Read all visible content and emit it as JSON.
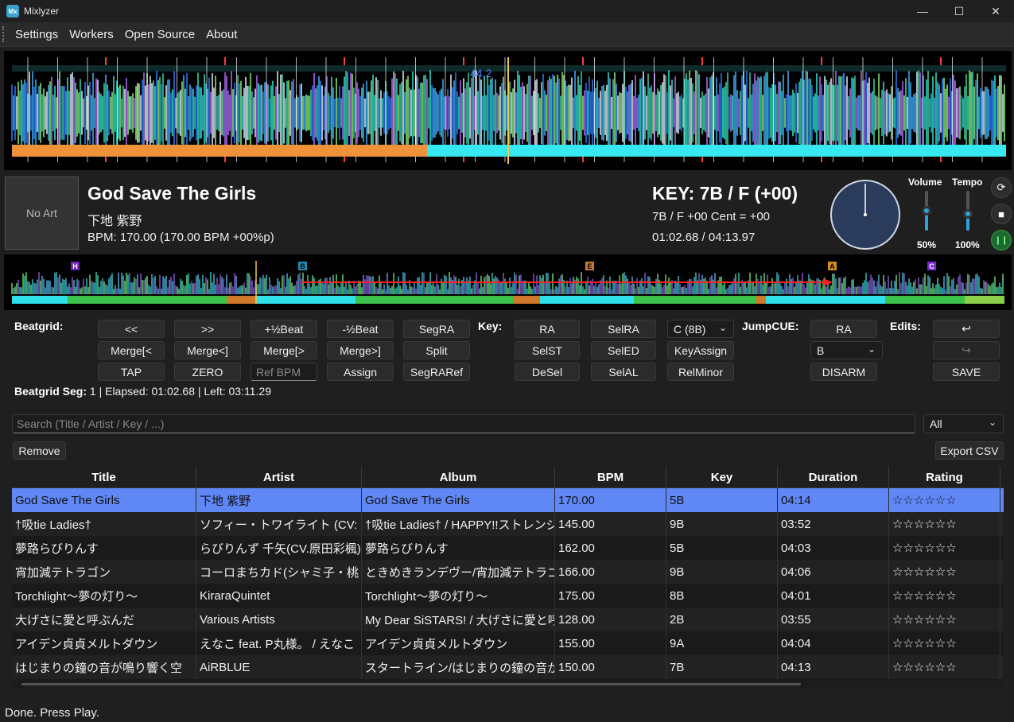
{
  "window": {
    "title": "Mixlyzer",
    "icon_text": "Mx",
    "minimize": "—",
    "maximize": "☐",
    "close": "✕"
  },
  "menu": [
    "Settings",
    "Workers",
    "Open Source",
    "About"
  ],
  "waveform": {
    "beat_label": "44.2"
  },
  "track": {
    "no_art": "No Art",
    "title": "God Save The Girls",
    "artist": "下地 紫野",
    "bpm": "BPM: 170.00 (170.00 BPM +00%p)",
    "key_big": "KEY: 7B / F (+00)",
    "key_detail": "7B / F +00 Cent = +00",
    "time": "01:02.68 / 04:13.97"
  },
  "mixer": {
    "volume_label": "Volume",
    "volume_value": "50%",
    "volume_level": 0.5,
    "tempo_label": "Tempo",
    "tempo_value": "100%",
    "tempo_level": 0.4,
    "reset_icon": "⟳",
    "stop_icon": "■",
    "play_icon": "❙❙"
  },
  "cue_labels": [
    "H",
    "B",
    "E",
    "A",
    "C"
  ],
  "beatgrid": {
    "label": "Beatgrid:",
    "buttons": [
      "<<",
      ">>",
      "+½Beat",
      "-½Beat",
      "SegRA",
      "Merge[<",
      "Merge<]",
      "Merge[>",
      "Merge>]",
      "Split",
      "TAP",
      "ZERO",
      "Assign",
      "SegRARef"
    ],
    "ref_bpm_placeholder": "Ref BPM"
  },
  "key": {
    "label": "Key:",
    "buttons": [
      "RA",
      "SelRA",
      "SelST",
      "SelED",
      "KeyAssign",
      "DeSel",
      "SelAL",
      "RelMinor"
    ],
    "select_value": "C (8B)"
  },
  "jumpcue": {
    "label": "JumpCUE:",
    "ra": "RA",
    "select_value": "B",
    "disarm": "DISARM"
  },
  "edits": {
    "label": "Edits:",
    "undo": "↩",
    "redo": "↪",
    "save": "SAVE"
  },
  "seg_status": {
    "label": "Beatgrid Seg:",
    "text": " 1 | Elapsed: 01:02.68 | Left: 03:11.29"
  },
  "search": {
    "placeholder": "Search (Title / Artist / Key / ...)",
    "filter": "All"
  },
  "remove_label": "Remove",
  "export_label": "Export CSV",
  "table": {
    "columns": [
      "Title",
      "Artist",
      "Album",
      "BPM",
      "Key",
      "Duration",
      "Rating"
    ],
    "rows": [
      [
        "God Save The Girls",
        "下地 紫野",
        "God Save The Girls",
        "170.00",
        "5B",
        "04:14",
        "☆☆☆☆☆☆"
      ],
      [
        "†吸tie Ladies†",
        "ソフィー・トワイライト (CV:",
        "†吸tie Ladies† / HAPPY!!ストレンジ",
        "145.00",
        "9B",
        "03:52",
        "☆☆☆☆☆☆"
      ],
      [
        "夢路らびりんす",
        "らびりんず 千矢(CV.原田彩楓)",
        "夢路らびりんす",
        "162.00",
        "5B",
        "04:03",
        "☆☆☆☆☆☆"
      ],
      [
        "宵加減テトラゴン",
        "コーロまちカド(シャミ子・桃",
        "ときめきランデヴー/宵加減テトラゴ",
        "166.00",
        "9B",
        "04:06",
        "☆☆☆☆☆☆"
      ],
      [
        "Torchlight～夢の灯り～",
        "KiraraQuintet",
        "Torchlight～夢の灯り～",
        "175.00",
        "8B",
        "04:01",
        "☆☆☆☆☆☆"
      ],
      [
        "大げさに愛と呼ぶんだ",
        "Various Artists",
        "My Dear SiSTARS! / 大げさに愛と呼",
        "128.00",
        "2B",
        "03:55",
        "☆☆☆☆☆☆"
      ],
      [
        "アイデン貞貞メルトダウン",
        "えなこ feat. P丸様。 / えなこ",
        "アイデン貞貞メルトダウン",
        "155.00",
        "9A",
        "04:04",
        "☆☆☆☆☆☆"
      ],
      [
        "はじまりの鐘の音が鳴り響く空",
        "AiRBLUE",
        "スタートライン/はじまりの鐘の音が",
        "150.00",
        "7B",
        "04:13",
        "☆☆☆☆☆☆"
      ]
    ]
  },
  "status": "Done. Press Play."
}
